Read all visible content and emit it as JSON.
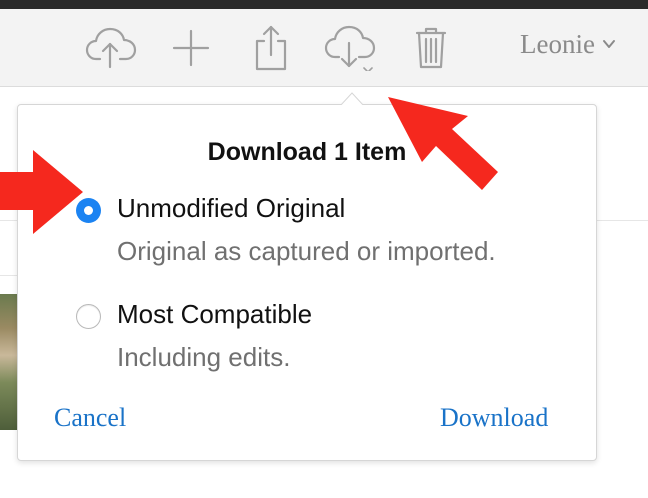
{
  "toolbar": {
    "icons": [
      "upload-cloud-icon",
      "add-icon",
      "share-icon",
      "download-cloud-icon",
      "trash-icon"
    ],
    "user_name": "Leonie",
    "icon_color": "#a0a0a0"
  },
  "dialog": {
    "title": "Download 1 Item",
    "options": [
      {
        "label": "Unmodified Original",
        "description": "Original as captured or imported.",
        "selected": true
      },
      {
        "label": "Most Compatible",
        "description": "Including edits.",
        "selected": false
      }
    ],
    "cancel_label": "Cancel",
    "download_label": "Download"
  },
  "colors": {
    "accent": "#1b83f2",
    "link": "#1a73c8",
    "annotation_arrow": "#f5281e"
  }
}
